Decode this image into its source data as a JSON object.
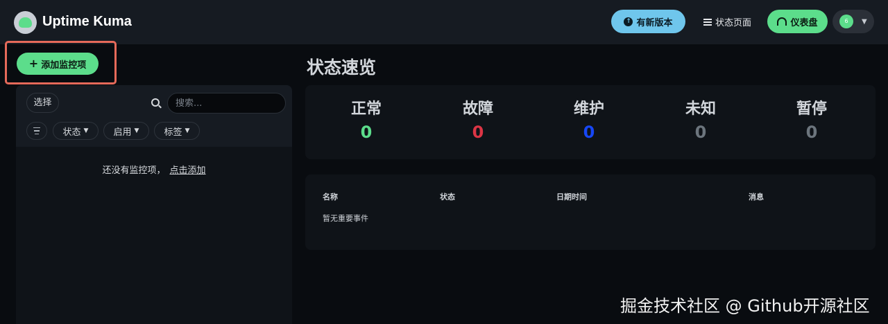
{
  "header": {
    "app_title": "Uptime Kuma",
    "update_button": "有新版本",
    "status_page_link": "状态页面",
    "dashboard_button": "仪表盘",
    "avatar_initial": "6"
  },
  "sidebar": {
    "add_monitor_button": "添加监控项",
    "select_button": "选择",
    "search_placeholder": "搜索...",
    "filters": [
      "状态",
      "启用",
      "标签"
    ],
    "empty_text": "还没有监控项，",
    "empty_link": "点击添加"
  },
  "main": {
    "title": "状态速览",
    "stats": [
      {
        "label": "正常",
        "value": "0",
        "color": "#5cdd8b"
      },
      {
        "label": "故障",
        "value": "0",
        "color": "#dc3545"
      },
      {
        "label": "维护",
        "value": "0",
        "color": "#1747f5"
      },
      {
        "label": "未知",
        "value": "0",
        "color": "#6c757d"
      },
      {
        "label": "暂停",
        "value": "0",
        "color": "#6c757d"
      }
    ],
    "events_table": {
      "columns": [
        "名称",
        "状态",
        "日期时间",
        "消息"
      ],
      "empty_text": "暂无重要事件"
    }
  },
  "watermark": "掘金技术社区 @ Github开源社区",
  "colors": {
    "accent_green": "#5cdd8b",
    "accent_blue": "#6fc6ec",
    "highlight_box": "#e66a5a"
  }
}
